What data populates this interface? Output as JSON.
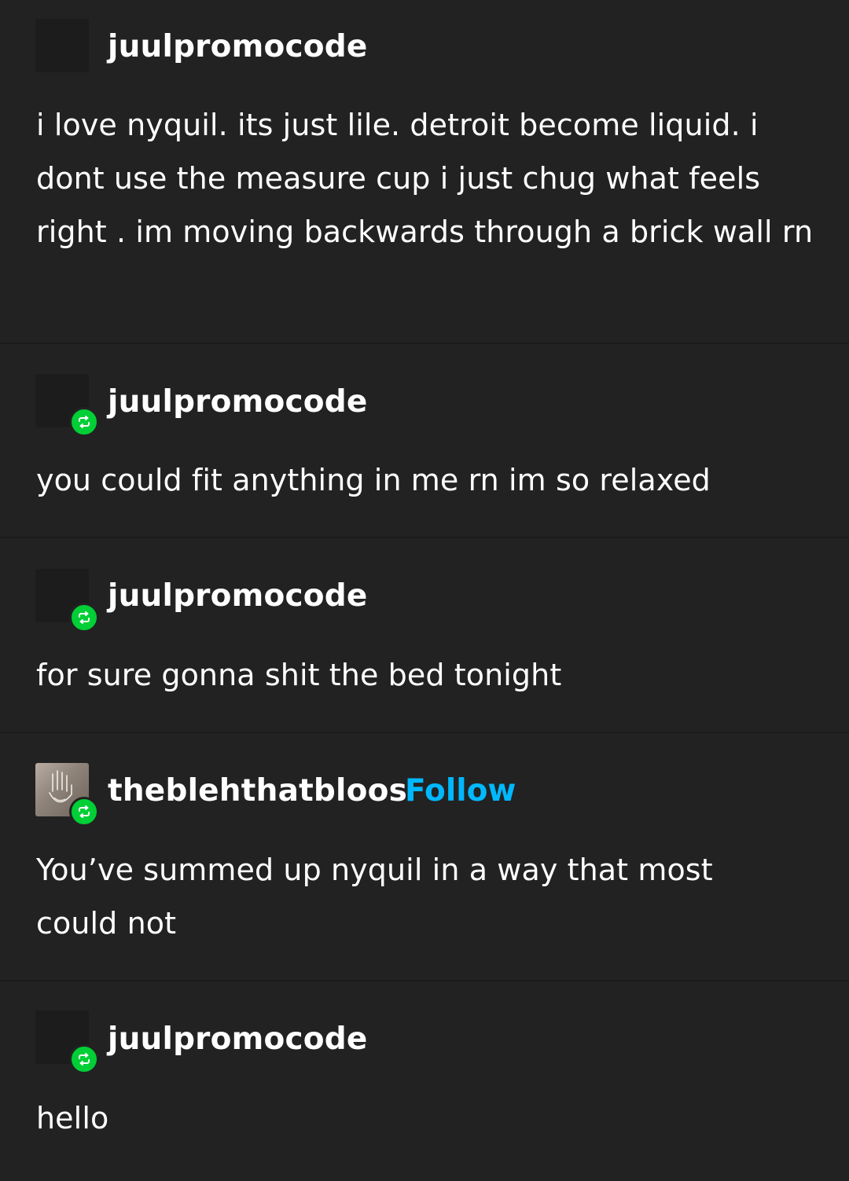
{
  "colors": {
    "background": "#222222",
    "text": "#ffffff",
    "follow_link": "#00b8ff",
    "reblog_badge": "#00cf35"
  },
  "posts": [
    {
      "username": "juulpromocode",
      "reblog_icon": false,
      "text": "i love nyquil. its just lile. detroit become liquid. i dont use the measure cup i just chug what feels right . im moving backwards through a brick wall rn"
    },
    {
      "username": "juulpromocode",
      "reblog_icon": "reblog-icon",
      "text": "you could fit anything in me rn im so relaxed"
    },
    {
      "username": "juulpromocode",
      "reblog_icon": "reblog-icon",
      "text": "for sure gonna shit the bed tonight"
    },
    {
      "username": "theblehthatbloos",
      "follow_label": "Follow",
      "reblog_icon": "reblog-icon",
      "text": "You’ve summed up nyquil in a way that most could not"
    },
    {
      "username": "juulpromocode",
      "reblog_icon": "reblog-icon",
      "text": "hello"
    }
  ]
}
